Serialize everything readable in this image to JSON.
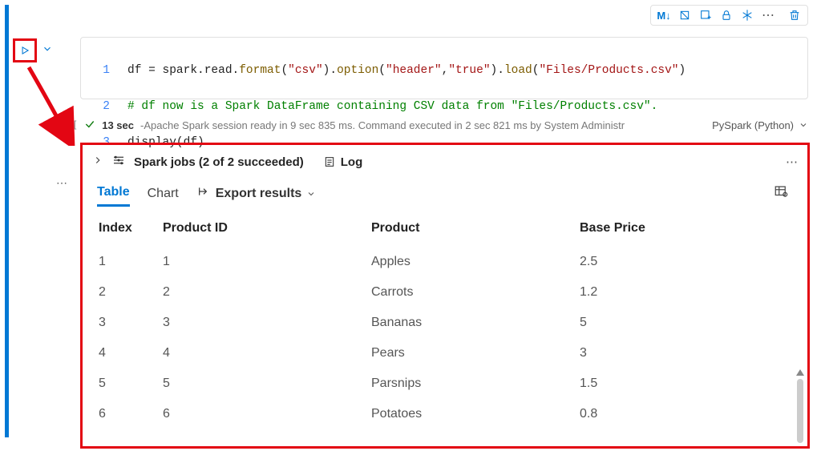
{
  "toolbar": {
    "markdown_label": "M↓"
  },
  "code": {
    "line1_a": "df = spark.read.",
    "line1_format": "format",
    "line1_b": "(",
    "line1_csv": "\"csv\"",
    "line1_c": ").",
    "line1_option": "option",
    "line1_d": "(",
    "line1_header": "\"header\"",
    "line1_comma": ",",
    "line1_true": "\"true\"",
    "line1_e": ").",
    "line1_load": "load",
    "line1_f": "(",
    "line1_path": "\"Files/Products.csv\"",
    "line1_g": ")",
    "line2": "# df now is a Spark DataFrame containing CSV data from \"Files/Products.csv\".",
    "line3_a": "display(df)"
  },
  "status": {
    "duration": "13 sec",
    "message": "-Apache Spark session ready in 9 sec 835 ms. Command executed in 2 sec 821 ms by System Administr",
    "language": "PySpark (Python)"
  },
  "jobs": {
    "label": "Spark jobs (2 of 2 succeeded)",
    "log": "Log"
  },
  "tabs": {
    "table": "Table",
    "chart": "Chart",
    "export": "Export results"
  },
  "table": {
    "headers": {
      "index": "Index",
      "product_id": "Product ID",
      "product": "Product",
      "base_price": "Base Price"
    },
    "rows": [
      {
        "index": "1",
        "product_id": "1",
        "product": "Apples",
        "base_price": "2.5"
      },
      {
        "index": "2",
        "product_id": "2",
        "product": "Carrots",
        "base_price": "1.2"
      },
      {
        "index": "3",
        "product_id": "3",
        "product": "Bananas",
        "base_price": "5"
      },
      {
        "index": "4",
        "product_id": "4",
        "product": "Pears",
        "base_price": "3"
      },
      {
        "index": "5",
        "product_id": "5",
        "product": "Parsnips",
        "base_price": "1.5"
      },
      {
        "index": "6",
        "product_id": "6",
        "product": "Potatoes",
        "base_price": "0.8"
      }
    ]
  }
}
